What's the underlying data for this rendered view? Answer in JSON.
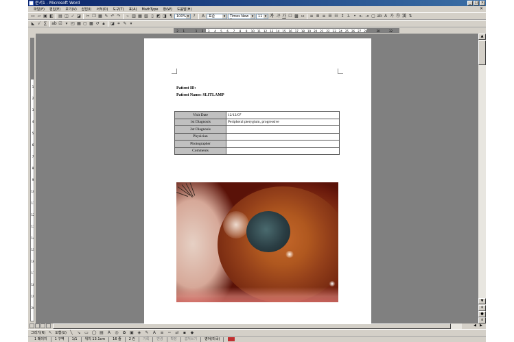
{
  "window": {
    "title": "문서1 - Microsoft Word",
    "controls": [
      "_",
      "□",
      "×"
    ]
  },
  "menubar": {
    "items": [
      "파일(F)",
      "편집(E)",
      "보기(V)",
      "삽입(I)",
      "서식(O)",
      "도구(T)",
      "표(A)",
      "MathType",
      "창(W)",
      "도움말(H)"
    ],
    "close": "×"
  },
  "toolbar": {
    "zoom": "100%",
    "style": "표준",
    "font": "Times New Roman",
    "size": "11"
  },
  "ruler": {
    "ticks": [
      "2",
      "1",
      "",
      "1",
      "2",
      "3",
      "4",
      "5",
      "6",
      "7",
      "8",
      "9",
      "10",
      "11",
      "12",
      "13",
      "14",
      "15",
      "16",
      "17",
      "18",
      "19",
      "20",
      "21",
      "22",
      "23",
      "24",
      "25",
      "26",
      "27",
      "28",
      "",
      "30",
      "",
      "32",
      ""
    ],
    "vticks": [
      "1",
      "2",
      "3",
      "4",
      "5",
      "6",
      "7",
      "8",
      "9",
      "10",
      "11",
      "12",
      "13",
      "14",
      "15",
      "16",
      "17",
      "18",
      "19",
      "20"
    ]
  },
  "document": {
    "patient_id": "Patient ID:",
    "patient_name": "Patient Name: SLITLAMP",
    "table": [
      {
        "label": "Visit Date",
        "value": "12/12/07"
      },
      {
        "label": "1st Diagnosis",
        "value": "Peripheral pterygium, progressive"
      },
      {
        "label": "2st Diagnosis",
        "value": ""
      },
      {
        "label": "Physician",
        "value": ""
      },
      {
        "label": "Photographer",
        "value": ""
      },
      {
        "label": "Comments",
        "value": ""
      }
    ]
  },
  "drawing_bar": {
    "draw_label": "그리기(R)",
    "autoshapes_label": "도형(U)"
  },
  "statusbar": {
    "page": "1 페이지",
    "section": "1 구역",
    "pages": "1/1",
    "position": "위치 13.1cm",
    "line": "16 줄",
    "column": "2 칸",
    "rec": "기록",
    "trk": "변경",
    "ext": "확장",
    "ovr": "겹쳐쓰기",
    "lang": "영어(미국)"
  }
}
